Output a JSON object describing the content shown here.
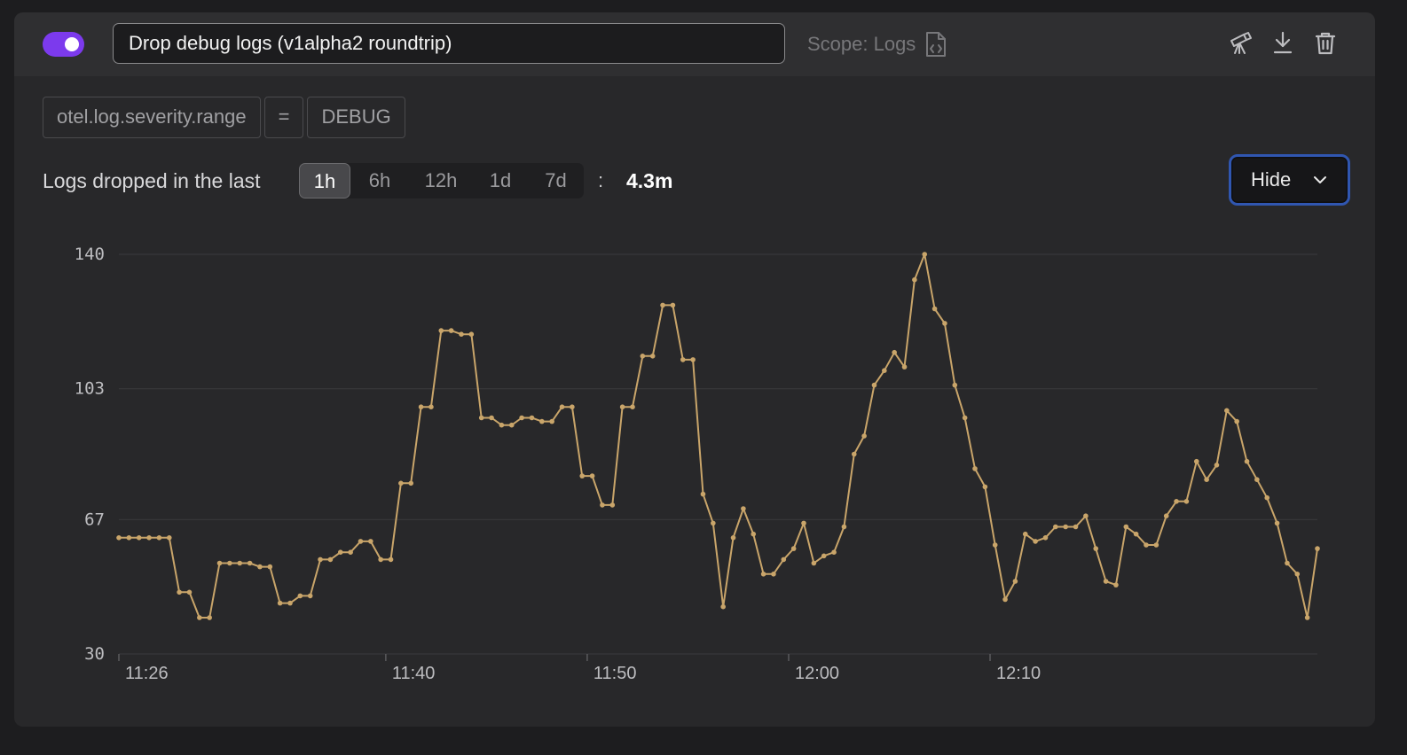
{
  "rule": {
    "enabled": true,
    "name": "Drop debug logs (v1alpha2 roundtrip)",
    "scope_label": "Scope: Logs"
  },
  "icons": {
    "toggle": "toggle-switch",
    "scope": "file-code-icon",
    "preview": "telescope-icon",
    "download": "download-icon",
    "delete": "trash-icon",
    "hide_chevron": "chevron-down-icon"
  },
  "filter": {
    "field": "otel.log.severity.range",
    "operator": "=",
    "value": "DEBUG"
  },
  "range": {
    "label": "Logs dropped in the last",
    "options": [
      "1h",
      "6h",
      "12h",
      "1d",
      "7d"
    ],
    "selected": "1h",
    "separator": ":",
    "total": "4.3m"
  },
  "hide_button": {
    "label": "Hide"
  },
  "colors": {
    "accent": "#7c3aed",
    "line": "#c9a56a",
    "focus_ring": "#3056b0"
  },
  "chart_data": {
    "type": "line",
    "title": "",
    "xlabel": "",
    "ylabel": "",
    "ylim": [
      30,
      140
    ],
    "yticks": [
      "140",
      "103",
      "67",
      "30"
    ],
    "xticks": [
      {
        "label": "11:26",
        "x": 0
      },
      {
        "label": "11:40",
        "x": 26.5
      },
      {
        "label": "11:50",
        "x": 46.5
      },
      {
        "label": "12:00",
        "x": 66.5
      },
      {
        "label": "12:10",
        "x": 86.5
      }
    ],
    "grid": true,
    "series": [
      {
        "values": [
          62,
          62,
          62,
          62,
          62,
          62,
          47,
          47,
          40,
          40,
          55,
          55,
          55,
          55,
          54,
          54,
          44,
          44,
          46,
          46,
          56,
          56,
          58,
          58,
          61,
          61,
          56,
          56,
          77,
          77,
          98,
          98,
          119,
          119,
          118,
          118,
          95,
          95,
          93,
          93,
          95,
          95,
          94,
          94,
          98,
          98,
          79,
          79,
          71,
          71,
          98,
          98,
          112,
          112,
          126,
          126,
          111,
          111,
          74,
          66,
          43,
          62,
          70,
          63,
          52,
          52,
          56,
          59,
          66,
          55,
          57,
          58,
          65,
          85,
          90,
          104,
          108,
          113,
          109,
          133,
          140,
          125,
          121,
          104,
          95,
          81,
          76,
          60,
          45,
          50,
          63,
          61,
          62,
          65,
          65,
          65,
          68,
          59,
          50,
          49,
          65,
          63,
          60,
          60,
          68,
          72,
          72,
          83,
          78,
          82,
          97,
          94,
          83,
          78,
          73,
          66,
          55,
          52,
          40,
          59
        ]
      }
    ]
  }
}
